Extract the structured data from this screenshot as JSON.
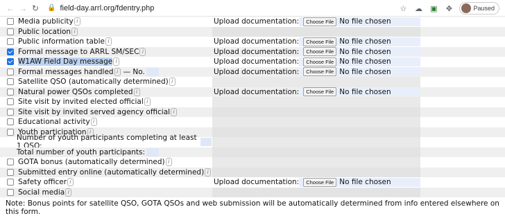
{
  "browser": {
    "url": "field-day.arrl.org/fdentry.php",
    "profile_status": "Paused"
  },
  "form": {
    "upload_label": "Upload documentation:",
    "choose_label": "Choose File",
    "no_file_label": "No file chosen",
    "rows": [
      {
        "label": "Media publicity",
        "checked": false,
        "upload": true
      },
      {
        "label": "Public location",
        "checked": false,
        "upload": false
      },
      {
        "label": "Public information table",
        "checked": false,
        "upload": true
      },
      {
        "label": "Formal message to ARRL SM/SEC",
        "checked": true,
        "upload": true
      },
      {
        "label": "W1AW Field Day message",
        "checked": true,
        "upload": true
      },
      {
        "label": "Formal messages handled",
        "suffix": "— No.",
        "checked": false,
        "upload": true
      },
      {
        "label": "Satellite QSO (automatically determined)",
        "checked": false,
        "upload": false
      },
      {
        "label": "Natural power QSOs completed",
        "checked": false,
        "upload": true
      },
      {
        "label": "Site visit by invited elected official",
        "checked": false,
        "upload": false
      },
      {
        "label": "Site visit by invited served agency official",
        "checked": false,
        "upload": false
      },
      {
        "label": "Educational activity",
        "checked": false,
        "upload": false
      },
      {
        "label": "Youth participation",
        "checked": false,
        "upload": false
      },
      {
        "label": "Number of youth participants completing at least 1 QSO:",
        "sub": true
      },
      {
        "label": "Total number of youth participants:",
        "sub": true
      },
      {
        "label": "GOTA bonus (automatically determined)",
        "checked": false,
        "upload": false
      },
      {
        "label": "Submitted entry online (automatically determined)",
        "checked": false,
        "upload": false
      },
      {
        "label": "Safety officer",
        "checked": false,
        "upload": true
      },
      {
        "label": "Social media",
        "checked": false,
        "upload": false
      }
    ]
  },
  "note": "Note: Bonus points for satellite QSO, GOTA QSOs and web submission will be automatically determined from info entered elsewhere on this form."
}
